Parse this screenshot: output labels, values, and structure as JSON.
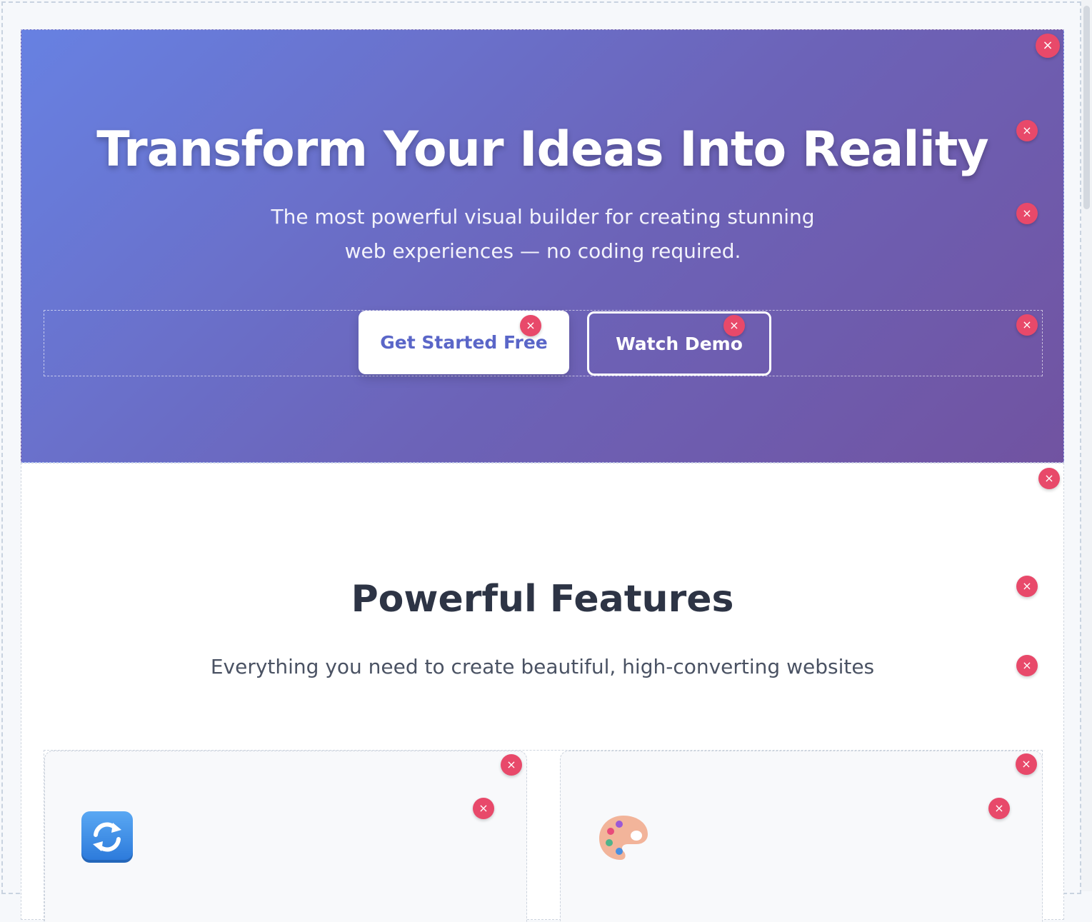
{
  "hero": {
    "title": "Transform Your Ideas Into Reality",
    "subtitle": "The most powerful visual builder for creating stunning web experiences — no coding required.",
    "primary_button": "Get Started Free",
    "secondary_button": "Watch Demo"
  },
  "features": {
    "title": "Powerful Features",
    "subtitle": "Everything you need to create beautiful, high-converting websites",
    "cards": [
      {
        "icon": "refresh-icon"
      },
      {
        "icon": "palette-icon"
      }
    ]
  },
  "controls": {
    "remove_glyph": "×"
  },
  "colors": {
    "hero_gradient_start": "#6781e2",
    "hero_gradient_end": "#7153a1",
    "remove_button": "#e8496a",
    "primary_button_text": "#5a66c8",
    "heading_text": "#2d3445"
  }
}
